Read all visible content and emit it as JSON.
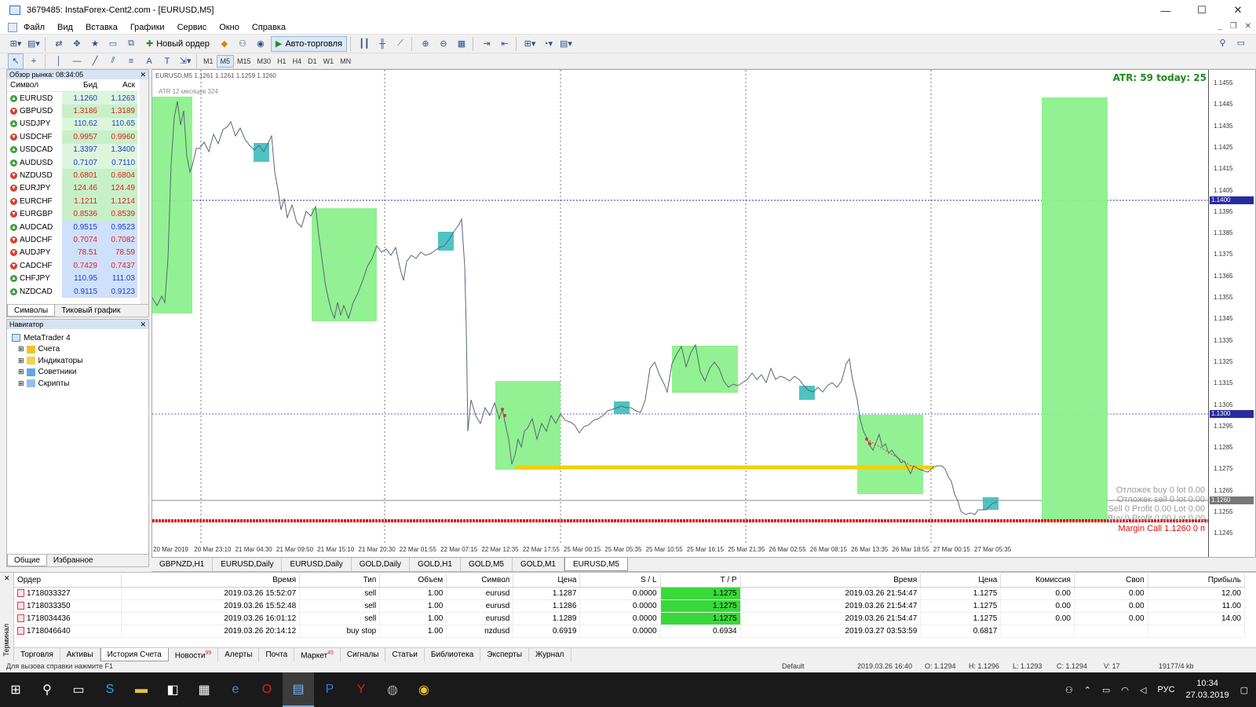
{
  "window": {
    "title": "3679485: InstaForex-Cent2.com - [EURUSD,M5]"
  },
  "menu": [
    "Файл",
    "Вид",
    "Вставка",
    "Графики",
    "Сервис",
    "Окно",
    "Справка"
  ],
  "toolbar": {
    "new_order": "Новый ордер",
    "auto_trading": "Авто-торговля"
  },
  "timeframes": [
    "M1",
    "M5",
    "M15",
    "M30",
    "H1",
    "H4",
    "D1",
    "W1",
    "MN"
  ],
  "active_timeframe": "M5",
  "market_watch": {
    "title": "Обзор рынка: 08:34:05",
    "col_symbol": "Символ",
    "col_bid": "Бид",
    "col_ask": "Аск",
    "rows": [
      {
        "symbol": "EURUSD",
        "bid": "1.1260",
        "ask": "1.1263",
        "dir": "up"
      },
      {
        "symbol": "GBPUSD",
        "bid": "1.3186",
        "ask": "1.3189",
        "dir": "down"
      },
      {
        "symbol": "USDJPY",
        "bid": "110.62",
        "ask": "110.65",
        "dir": "up"
      },
      {
        "symbol": "USDCHF",
        "bid": "0.9957",
        "ask": "0.9960",
        "dir": "down"
      },
      {
        "symbol": "USDCAD",
        "bid": "1.3397",
        "ask": "1.3400",
        "dir": "up"
      },
      {
        "symbol": "AUDUSD",
        "bid": "0.7107",
        "ask": "0.7110",
        "dir": "up"
      },
      {
        "symbol": "NZDUSD",
        "bid": "0.6801",
        "ask": "0.6804",
        "dir": "down"
      },
      {
        "symbol": "EURJPY",
        "bid": "124.46",
        "ask": "124.49",
        "dir": "down"
      },
      {
        "symbol": "EURCHF",
        "bid": "1.1211",
        "ask": "1.1214",
        "dir": "down"
      },
      {
        "symbol": "EURGBP",
        "bid": "0.8536",
        "ask": "0.8539",
        "dir": "down"
      },
      {
        "symbol": "AUDCAD",
        "bid": "0.9515",
        "ask": "0.9523",
        "dir": "up"
      },
      {
        "symbol": "AUDCHF",
        "bid": "0.7074",
        "ask": "0.7082",
        "dir": "down"
      },
      {
        "symbol": "AUDJPY",
        "bid": "78.51",
        "ask": "78.59",
        "dir": "down"
      },
      {
        "symbol": "CADCHF",
        "bid": "0.7429",
        "ask": "0.7437",
        "dir": "down"
      },
      {
        "symbol": "CHFJPY",
        "bid": "110.95",
        "ask": "111.03",
        "dir": "up"
      },
      {
        "symbol": "NZDCAD",
        "bid": "0.9115",
        "ask": "0.9123",
        "dir": "up"
      }
    ],
    "tabs": [
      "Символы",
      "Тиковый график"
    ]
  },
  "navigator": {
    "title": "Навигатор",
    "items": [
      "MetaTrader 4",
      "Счета",
      "Индикаторы",
      "Советники",
      "Скрипты"
    ],
    "tabs": [
      "Общие",
      "Избранное"
    ]
  },
  "chart": {
    "header": "EURUSD,M5 1.1261 1.1261 1.1259 1.1260",
    "indicator_label": "ATR 12 месяцев 324",
    "atr_label": "ATR: 59  today: 25",
    "price_labels": [
      "1.1455",
      "1.1445",
      "1.1435",
      "1.1425",
      "1.1415",
      "1.1405",
      "1.1395",
      "1.1385",
      "1.1375",
      "1.1365",
      "1.1355",
      "1.1345",
      "1.1335",
      "1.1325",
      "1.1315",
      "1.1305",
      "1.1295",
      "1.1285",
      "1.1275",
      "1.1265",
      "1.1255",
      "1.1245"
    ],
    "level_flags": {
      "upper": "1.1400",
      "middle": "1.1300",
      "current": "1.1260"
    },
    "time_labels": [
      "20 Mar 2019",
      "20 Mar 23:10",
      "21 Mar 04:30",
      "21 Mar 09:50",
      "21 Mar 15:10",
      "21 Mar 20:30",
      "22 Mar 01:55",
      "22 Mar 07:15",
      "22 Mar 12:35",
      "22 Mar 17:55",
      "25 Mar 00:15",
      "25 Mar 05:35",
      "25 Mar 10:55",
      "25 Mar 16:15",
      "25 Mar 21:35",
      "26 Mar 02:55",
      "26 Mar 08:15",
      "26 Mar 13:35",
      "26 Mar 18:55",
      "27 Mar 00:15",
      "27 Mar 05:35"
    ],
    "order_info": [
      "Отложек buy 0   lot 0.00",
      "Отложек sell 0   lot 0.00",
      "Sell 0  Profit 0.00  Lot 0.00",
      "Buy 0  Profit 0.00  Lot 0.00"
    ],
    "margin_call": "Margin Call 1.1260    0 п"
  },
  "chart_tabs": [
    "GBPNZD,H1",
    "EURUSD,Daily",
    "EURUSD,Daily",
    "GOLD,Daily",
    "GOLD,H1",
    "GOLD,M5",
    "GOLD,M1",
    "EURUSD,M5"
  ],
  "terminal": {
    "side_label": "Терминал",
    "headers": [
      "Ордер",
      "Время",
      "Тип",
      "Объем",
      "Символ",
      "Цена",
      "S / L",
      "T / P",
      "Время",
      "Цена",
      "Комиссия",
      "Своп",
      "Прибыль"
    ],
    "rows": [
      [
        "1718033327",
        "2019.03.26 15:52:07",
        "sell",
        "1.00",
        "eurusd",
        "1.1287",
        "0.0000",
        "1.1275",
        "2019.03.26 21:54:47",
        "1.1275",
        "0.00",
        "0.00",
        "12.00"
      ],
      [
        "1718033350",
        "2019.03.26 15:52:48",
        "sell",
        "1.00",
        "eurusd",
        "1.1286",
        "0.0000",
        "1.1275",
        "2019.03.26 21:54:47",
        "1.1275",
        "0.00",
        "0.00",
        "11.00"
      ],
      [
        "1718034436",
        "2019.03.26 16:01:12",
        "sell",
        "1.00",
        "eurusd",
        "1.1289",
        "0.0000",
        "1.1275",
        "2019.03.26 21:54:47",
        "1.1275",
        "0.00",
        "0.00",
        "14.00"
      ],
      [
        "1718046640",
        "2019.03.26 20:14:12",
        "buy stop",
        "1.00",
        "nzdusd",
        "0.6919",
        "0.0000",
        "0.6934",
        "2019.03.27 03:53:59",
        "0.6817",
        "",
        "",
        ""
      ]
    ],
    "tabs": [
      "Торговля",
      "Активы",
      "История Счета",
      "Новости",
      "Алерты",
      "Почта",
      "Маркет",
      "Сигналы",
      "Статьи",
      "Библиотека",
      "Эксперты",
      "Журнал"
    ],
    "badges": {
      "Новости": "99",
      "Маркет": "45"
    },
    "active_tab": "История Счета"
  },
  "statusbar": {
    "help": "Для вызова справки нажмите F1",
    "profile": "Default",
    "datetime": "2019.03.26 16:40",
    "open": "O: 1.1294",
    "high": "H: 1.1296",
    "low": "L: 1.1293",
    "close": "C: 1.1294",
    "volume": "V: 17",
    "traffic": "19177/4 kb"
  },
  "taskbar": {
    "lang": "РУС",
    "time": "10:34",
    "date": "27.03.2019"
  }
}
